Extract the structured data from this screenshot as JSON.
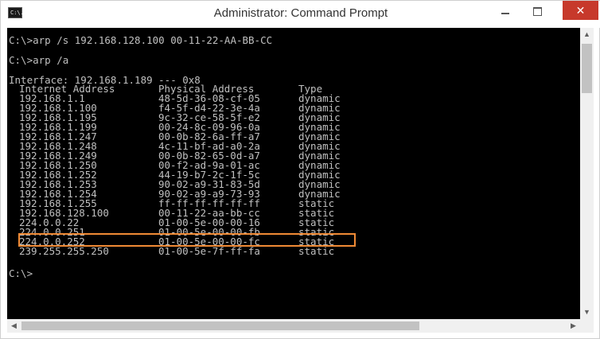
{
  "window": {
    "title": "Administrator: Command Prompt",
    "icon_label": "C:\\."
  },
  "console": {
    "cmd1": "C:\\>arp /s 192.168.128.100 00-11-22-AA-BB-CC",
    "cmd2": "C:\\>arp /a",
    "interface": "Interface: 192.168.1.189 --- 0x8",
    "headers": {
      "ip": "Internet Address",
      "mac": "Physical Address",
      "type": "Type"
    },
    "rows": [
      {
        "ip": "192.168.1.1",
        "mac": "48-5d-36-08-cf-05",
        "type": "dynamic"
      },
      {
        "ip": "192.168.1.100",
        "mac": "f4-5f-d4-22-3e-4a",
        "type": "dynamic"
      },
      {
        "ip": "192.168.1.195",
        "mac": "9c-32-ce-58-5f-e2",
        "type": "dynamic"
      },
      {
        "ip": "192.168.1.199",
        "mac": "00-24-8c-09-96-0a",
        "type": "dynamic"
      },
      {
        "ip": "192.168.1.247",
        "mac": "00-0b-82-6a-ff-a7",
        "type": "dynamic"
      },
      {
        "ip": "192.168.1.248",
        "mac": "4c-11-bf-ad-a0-2a",
        "type": "dynamic"
      },
      {
        "ip": "192.168.1.249",
        "mac": "00-0b-82-65-0d-a7",
        "type": "dynamic"
      },
      {
        "ip": "192.168.1.250",
        "mac": "00-f2-ad-9a-01-ac",
        "type": "dynamic"
      },
      {
        "ip": "192.168.1.252",
        "mac": "44-19-b7-2c-1f-5c",
        "type": "dynamic"
      },
      {
        "ip": "192.168.1.253",
        "mac": "90-02-a9-31-83-5d",
        "type": "dynamic"
      },
      {
        "ip": "192.168.1.254",
        "mac": "90-02-a9-a9-73-93",
        "type": "dynamic"
      },
      {
        "ip": "192.168.1.255",
        "mac": "ff-ff-ff-ff-ff-ff",
        "type": "static"
      },
      {
        "ip": "192.168.128.100",
        "mac": "00-11-22-aa-bb-cc",
        "type": "static"
      },
      {
        "ip": "224.0.0.22",
        "mac": "01-00-5e-00-00-16",
        "type": "static"
      },
      {
        "ip": "224.0.0.251",
        "mac": "01-00-5e-00-00-fb",
        "type": "static"
      },
      {
        "ip": "224.0.0.252",
        "mac": "01-00-5e-00-00-fc",
        "type": "static"
      },
      {
        "ip": "239.255.255.250",
        "mac": "01-00-5e-7f-ff-fa",
        "type": "static"
      }
    ],
    "prompt": "C:\\>"
  },
  "colors": {
    "console_background": "#000000",
    "console_text": "#c0c0c0",
    "highlight_border": "#f08a35",
    "close_button": "#c7392b"
  },
  "icons": {
    "app": "cmd-icon",
    "minimize": "minimize-icon",
    "maximize": "maximize-icon",
    "close": "close-icon"
  }
}
